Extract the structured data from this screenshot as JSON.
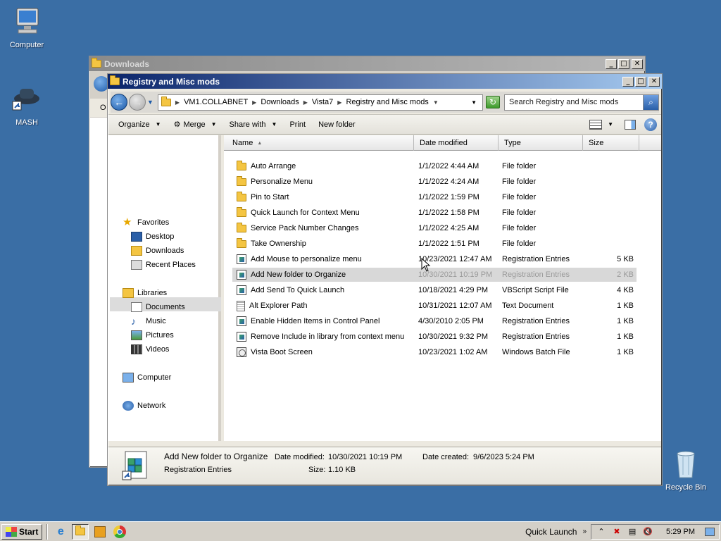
{
  "desktop": {
    "icons": [
      {
        "label": "Computer"
      },
      {
        "label": "MASH"
      },
      {
        "label": "Recycle Bin"
      }
    ]
  },
  "back_window": {
    "title": "Downloads",
    "partial_cmd": "O"
  },
  "window": {
    "title": "Registry and Misc mods",
    "breadcrumb": [
      "VM1.COLLABNET",
      "Downloads",
      "Vista7",
      "Registry and Misc mods"
    ],
    "search_placeholder": "Search Registry and Misc mods",
    "commands": [
      "Organize",
      "Merge",
      "Share with",
      "Print",
      "New folder"
    ]
  },
  "nav_pane": {
    "favorites": {
      "label": "Favorites",
      "items": [
        "Desktop",
        "Downloads",
        "Recent Places"
      ]
    },
    "libraries": {
      "label": "Libraries",
      "items": [
        "Documents",
        "Music",
        "Pictures",
        "Videos"
      ]
    },
    "computer": "Computer",
    "network": "Network"
  },
  "columns": {
    "name": "Name",
    "date": "Date modified",
    "type": "Type",
    "size": "Size"
  },
  "files": [
    {
      "name": "Auto Arrange",
      "date": "1/1/2022 4:44 AM",
      "type": "File folder",
      "size": "",
      "icon": "folder-icon"
    },
    {
      "name": "Personalize Menu",
      "date": "1/1/2022 4:24 AM",
      "type": "File folder",
      "size": "",
      "icon": "folder-icon"
    },
    {
      "name": "Pin to Start",
      "date": "1/1/2022 1:59 PM",
      "type": "File folder",
      "size": "",
      "icon": "folder-icon"
    },
    {
      "name": "Quick Launch for Context Menu",
      "date": "1/1/2022 1:58 PM",
      "type": "File folder",
      "size": "",
      "icon": "folder-icon"
    },
    {
      "name": "Service Pack Number Changes",
      "date": "1/1/2022 4:25 AM",
      "type": "File folder",
      "size": "",
      "icon": "folder-icon"
    },
    {
      "name": "Take Ownership",
      "date": "1/1/2022 1:51 PM",
      "type": "File folder",
      "size": "",
      "icon": "folder-icon"
    },
    {
      "name": "Add Mouse to personalize menu",
      "date": "10/23/2021 12:47 AM",
      "type": "Registration Entries",
      "size": "5 KB",
      "icon": "registry-icon"
    },
    {
      "name": "Add New folder to Organize",
      "date": "10/30/2021 10:19 PM",
      "type": "Registration Entries",
      "size": "2 KB",
      "icon": "registry-icon",
      "selected": true
    },
    {
      "name": "Add Send To Quick Launch",
      "date": "10/18/2021 4:29 PM",
      "type": "VBScript Script File",
      "size": "4 KB",
      "icon": "script-icon"
    },
    {
      "name": "Alt Explorer Path",
      "date": "10/31/2021 12:07 AM",
      "type": "Text Document",
      "size": "1 KB",
      "icon": "text-icon"
    },
    {
      "name": "Enable Hidden Items in Control Panel",
      "date": "4/30/2010 2:05 PM",
      "type": "Registration Entries",
      "size": "1 KB",
      "icon": "registry-icon"
    },
    {
      "name": "Remove Include in library from context menu",
      "date": "10/30/2021 9:32 PM",
      "type": "Registration Entries",
      "size": "1 KB",
      "icon": "registry-icon"
    },
    {
      "name": "Vista Boot Screen",
      "date": "10/23/2021 1:02 AM",
      "type": "Windows Batch File",
      "size": "1 KB",
      "icon": "batch-icon"
    }
  ],
  "details": {
    "name": "Add New folder to Organize",
    "type": "Registration Entries",
    "modified_label": "Date modified:",
    "modified": "10/30/2021 10:19 PM",
    "created_label": "Date created:",
    "created": "9/6/2023 5:24 PM",
    "size_label": "Size:",
    "size": "1.10 KB"
  },
  "taskbar": {
    "start": "Start",
    "quick_launch": "Quick Launch",
    "time": "5:29 PM"
  },
  "colors": {
    "desktop": "#3a6ea5",
    "active_title": "#0a246a",
    "selection": "#d8d8d8"
  }
}
